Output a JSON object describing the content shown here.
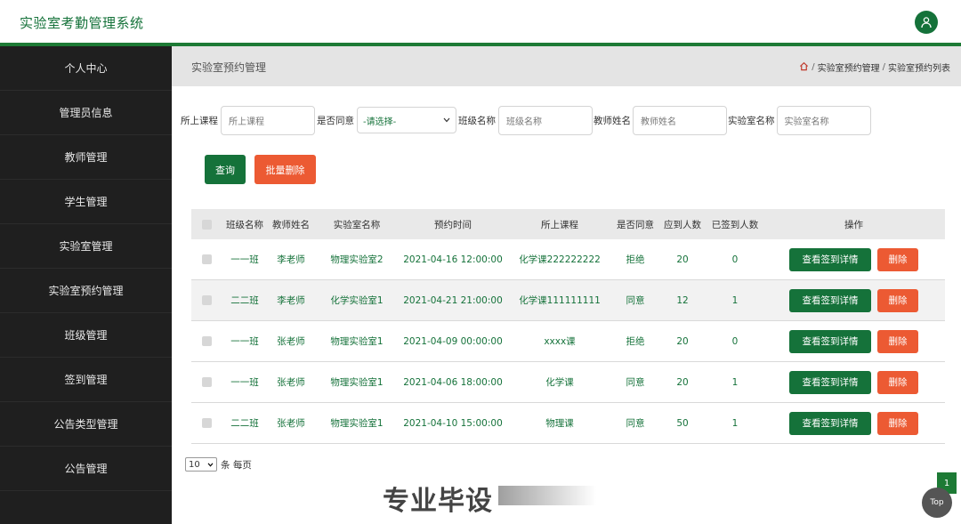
{
  "app": {
    "title": "实验室考勤管理系统"
  },
  "sidebar": {
    "items": [
      {
        "label": "个人中心"
      },
      {
        "label": "管理员信息"
      },
      {
        "label": "教师管理"
      },
      {
        "label": "学生管理"
      },
      {
        "label": "实验室管理"
      },
      {
        "label": "实验室预约管理"
      },
      {
        "label": "班级管理"
      },
      {
        "label": "签到管理"
      },
      {
        "label": "公告类型管理"
      },
      {
        "label": "公告管理"
      }
    ]
  },
  "header": {
    "page_title": "实验室预约管理",
    "breadcrumb": {
      "sep1": "/",
      "crumb1": "实验室预约管理",
      "sep2": "/",
      "crumb2": "实验室预约列表"
    }
  },
  "filters": {
    "course_label": "所上课程",
    "course_placeholder": "所上课程",
    "agree_label": "是否同意",
    "agree_value": "-请选择-",
    "class_label": "班级名称",
    "class_placeholder": "班级名称",
    "teacher_label": "教师姓名",
    "teacher_placeholder": "教师姓名",
    "lab_label": "实验室名称",
    "lab_placeholder": "实验室名称"
  },
  "actions": {
    "query_label": "查询",
    "bulk_delete_label": "批量删除"
  },
  "table": {
    "headers": [
      "班级名称",
      "教师姓名",
      "实验室名称",
      "预约时间",
      "所上课程",
      "是否同意",
      "应到人数",
      "已签到人数",
      "操作"
    ],
    "view_label": "查看签到详情",
    "delete_label": "删除",
    "rows": [
      {
        "class": "一一班",
        "teacher": "李老师",
        "lab": "物理实验室2",
        "time": "2021-04-16 12:00:00",
        "course": "化学课222222222",
        "agree": "拒绝",
        "due": "20",
        "signed": "0"
      },
      {
        "class": "二二班",
        "teacher": "李老师",
        "lab": "化学实验室1",
        "time": "2021-04-21 21:00:00",
        "course": "化学课111111111",
        "agree": "同意",
        "due": "12",
        "signed": "1"
      },
      {
        "class": "一一班",
        "teacher": "张老师",
        "lab": "物理实验室1",
        "time": "2021-04-09 00:00:00",
        "course": "xxxx课",
        "agree": "拒绝",
        "due": "20",
        "signed": "0"
      },
      {
        "class": "一一班",
        "teacher": "张老师",
        "lab": "物理实验室1",
        "time": "2021-04-06 18:00:00",
        "course": "化学课",
        "agree": "同意",
        "due": "20",
        "signed": "1"
      },
      {
        "class": "二二班",
        "teacher": "张老师",
        "lab": "物理实验室1",
        "time": "2021-04-10 15:00:00",
        "course": "物理课",
        "agree": "同意",
        "due": "50",
        "signed": "1"
      }
    ]
  },
  "pagination": {
    "page_size": "10",
    "per_page_text": "条 每页",
    "current_page": "1"
  },
  "top_button": {
    "label": "Top"
  },
  "watermark": {
    "text": "专业毕设"
  },
  "colors": {
    "primary": "#15723a",
    "danger": "#ec5a33",
    "sidebar_bg": "#1f1f1f"
  },
  "icons": {
    "home": "home-icon",
    "user": "user-icon",
    "chevron": "chevron-down-icon"
  }
}
